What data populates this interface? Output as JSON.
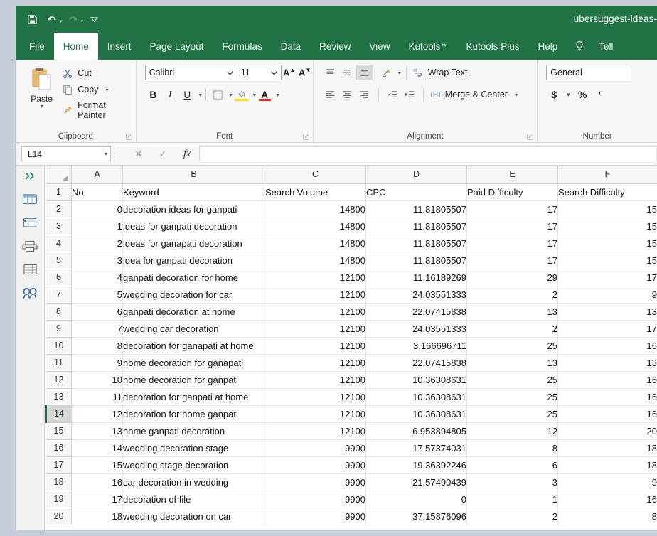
{
  "titlebar": {
    "document_title": "ubersuggest-ideas-",
    "qat": [
      {
        "name": "save-button",
        "icon": "save-icon",
        "label": "Save"
      },
      {
        "name": "undo-button",
        "icon": "undo-icon",
        "label": "Undo"
      },
      {
        "name": "redo-button",
        "icon": "redo-icon",
        "label": "Redo"
      },
      {
        "name": "customize-quick-access-toolbar-button",
        "icon": "chevron-down-icon",
        "label": "Customize Quick Access Toolbar"
      }
    ]
  },
  "ribbon_tabs": [
    {
      "label": "File",
      "active": false
    },
    {
      "label": "Home",
      "active": true
    },
    {
      "label": "Insert",
      "active": false
    },
    {
      "label": "Page Layout",
      "active": false
    },
    {
      "label": "Formulas",
      "active": false
    },
    {
      "label": "Data",
      "active": false
    },
    {
      "label": "Review",
      "active": false
    },
    {
      "label": "View",
      "active": false
    },
    {
      "label": "Kutools",
      "tm": "™",
      "active": false
    },
    {
      "label": "Kutools Plus",
      "active": false
    },
    {
      "label": "Help",
      "active": false
    },
    {
      "label": "Tell",
      "active": false
    }
  ],
  "ribbon": {
    "clipboard": {
      "group_label": "Clipboard",
      "paste_label": "Paste",
      "cut_label": "Cut",
      "copy_label": "Copy",
      "format_painter_label": "Format Painter"
    },
    "font": {
      "group_label": "Font",
      "font_name": "Calibri",
      "font_size": "11",
      "bold_label": "B",
      "italic_label": "I",
      "underline_label": "U",
      "grow_font_label": "A",
      "shrink_font_label": "A"
    },
    "alignment": {
      "group_label": "Alignment",
      "wrap_text_label": "Wrap Text",
      "merge_center_label": "Merge & Center"
    },
    "number": {
      "group_label": "Number",
      "number_format": "General",
      "currency_label": "$",
      "percent_label": "%",
      "comma_label": "’"
    }
  },
  "formula_bar": {
    "name_box_value": "L14",
    "formula_value": "",
    "cancel_label": "✕",
    "enter_label": "✓",
    "insert_function_label": "fx"
  },
  "kutools_sidebar": [
    {
      "name": "expand-pane-icon",
      "label": "Expand"
    },
    {
      "name": "workbook-icon",
      "label": "Navigation Workbook"
    },
    {
      "name": "worksheet-icon",
      "label": "Navigation Worksheet"
    },
    {
      "name": "printer-icon",
      "label": "Print"
    },
    {
      "name": "table-icon",
      "label": "Columns"
    },
    {
      "name": "find-replace-icon",
      "label": "Find and Replace"
    }
  ],
  "spreadsheet": {
    "column_letters": [
      "A",
      "B",
      "C",
      "D",
      "E",
      "F"
    ],
    "selected_row": 14,
    "header_row_number": 1,
    "headers": [
      "No",
      "Keyword",
      "Search Volume",
      "CPC",
      "Paid Difficulty",
      "Search Difficulty"
    ],
    "rows": [
      {
        "row": 2,
        "no": "0",
        "keyword": "decoration ideas for ganpati",
        "volume": "14800",
        "cpc": "11.81805507",
        "paid": "17",
        "search": "15"
      },
      {
        "row": 3,
        "no": "1",
        "keyword": "ideas for ganpati decoration",
        "volume": "14800",
        "cpc": "11.81805507",
        "paid": "17",
        "search": "15"
      },
      {
        "row": 4,
        "no": "2",
        "keyword": "ideas for ganapati decoration",
        "volume": "14800",
        "cpc": "11.81805507",
        "paid": "17",
        "search": "15"
      },
      {
        "row": 5,
        "no": "3",
        "keyword": "idea for ganpati decoration",
        "volume": "14800",
        "cpc": "11.81805507",
        "paid": "17",
        "search": "15"
      },
      {
        "row": 6,
        "no": "4",
        "keyword": "ganpati decoration for home",
        "volume": "12100",
        "cpc": "11.16189269",
        "paid": "29",
        "search": "17"
      },
      {
        "row": 7,
        "no": "5",
        "keyword": "wedding decoration for car",
        "volume": "12100",
        "cpc": "24.03551333",
        "paid": "2",
        "search": "9"
      },
      {
        "row": 8,
        "no": "6",
        "keyword": "ganpati decoration at home",
        "volume": "12100",
        "cpc": "22.07415838",
        "paid": "13",
        "search": "13"
      },
      {
        "row": 9,
        "no": "7",
        "keyword": "wedding car decoration",
        "volume": "12100",
        "cpc": "24.03551333",
        "paid": "2",
        "search": "17"
      },
      {
        "row": 10,
        "no": "8",
        "keyword": "decoration for ganapati at home",
        "volume": "12100",
        "cpc": "3.166696711",
        "paid": "25",
        "search": "16"
      },
      {
        "row": 11,
        "no": "9",
        "keyword": "home decoration for ganapati",
        "volume": "12100",
        "cpc": "22.07415838",
        "paid": "13",
        "search": "13"
      },
      {
        "row": 12,
        "no": "10",
        "keyword": "home decoration for ganpati",
        "volume": "12100",
        "cpc": "10.36308631",
        "paid": "25",
        "search": "16"
      },
      {
        "row": 13,
        "no": "11",
        "keyword": "decoration for ganpati at home",
        "volume": "12100",
        "cpc": "10.36308631",
        "paid": "25",
        "search": "16"
      },
      {
        "row": 14,
        "no": "12",
        "keyword": "decoration for home ganpati",
        "volume": "12100",
        "cpc": "10.36308631",
        "paid": "25",
        "search": "16"
      },
      {
        "row": 15,
        "no": "13",
        "keyword": "home ganpati decoration",
        "volume": "12100",
        "cpc": "6.953894805",
        "paid": "12",
        "search": "20"
      },
      {
        "row": 16,
        "no": "14",
        "keyword": "wedding decoration stage",
        "volume": "9900",
        "cpc": "17.57374031",
        "paid": "8",
        "search": "18"
      },
      {
        "row": 17,
        "no": "15",
        "keyword": "wedding stage decoration",
        "volume": "9900",
        "cpc": "19.36392246",
        "paid": "6",
        "search": "18"
      },
      {
        "row": 18,
        "no": "16",
        "keyword": "car decoration in wedding",
        "volume": "9900",
        "cpc": "21.57490439",
        "paid": "3",
        "search": "9"
      },
      {
        "row": 19,
        "no": "17",
        "keyword": "decoration of file",
        "volume": "9900",
        "cpc": "0",
        "paid": "1",
        "search": "16"
      },
      {
        "row": 20,
        "no": "18",
        "keyword": "wedding decoration on car",
        "volume": "9900",
        "cpc": "37.15876096",
        "paid": "2",
        "search": "8"
      }
    ]
  },
  "colors": {
    "excel_green": "#217346",
    "ribbon_bg": "#f6f6f6",
    "outer_bg": "#c6ced9"
  }
}
